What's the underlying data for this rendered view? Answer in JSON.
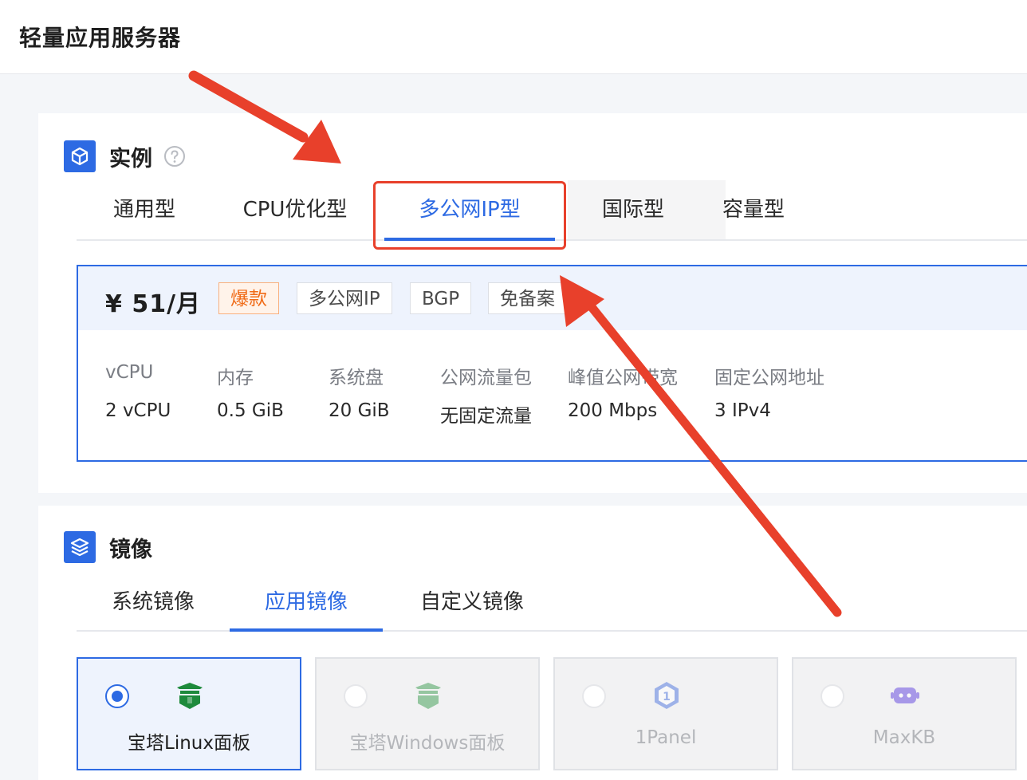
{
  "page": {
    "title": "轻量应用服务器"
  },
  "instance": {
    "section_title": "实例",
    "tabs": [
      "通用型",
      "CPU优化型",
      "多公网IP型",
      "国际型",
      "容量型"
    ],
    "active_tab": "多公网IP型",
    "plan": {
      "price": "¥ 51/月",
      "tags": [
        "爆款",
        "多公网IP",
        "BGP",
        "免备案"
      ],
      "specs": [
        {
          "label": "vCPU",
          "value": "2 vCPU"
        },
        {
          "label": "内存",
          "value": "0.5 GiB"
        },
        {
          "label": "系统盘",
          "value": "20 GiB"
        },
        {
          "label": "公网流量包",
          "value": "无固定流量"
        },
        {
          "label": "峰值公网带宽",
          "value": "200 Mbps"
        },
        {
          "label": "固定公网地址",
          "value": "3 IPv4"
        }
      ]
    }
  },
  "image": {
    "section_title": "镜像",
    "tabs": [
      "系统镜像",
      "应用镜像",
      "自定义镜像"
    ],
    "active_tab": "应用镜像",
    "options": [
      {
        "name": "宝塔Linux面板",
        "icon": "baota-icon",
        "selected": true
      },
      {
        "name": "宝塔Windows面板",
        "icon": "baota-icon",
        "selected": false
      },
      {
        "name": "1Panel",
        "icon": "1panel-icon",
        "selected": false
      },
      {
        "name": "MaxKB",
        "icon": "maxkb-icon",
        "selected": false
      }
    ]
  },
  "colors": {
    "accent": "#2d6ae3",
    "hot_tag": "#f06a16",
    "annotation": "#e8402b"
  }
}
